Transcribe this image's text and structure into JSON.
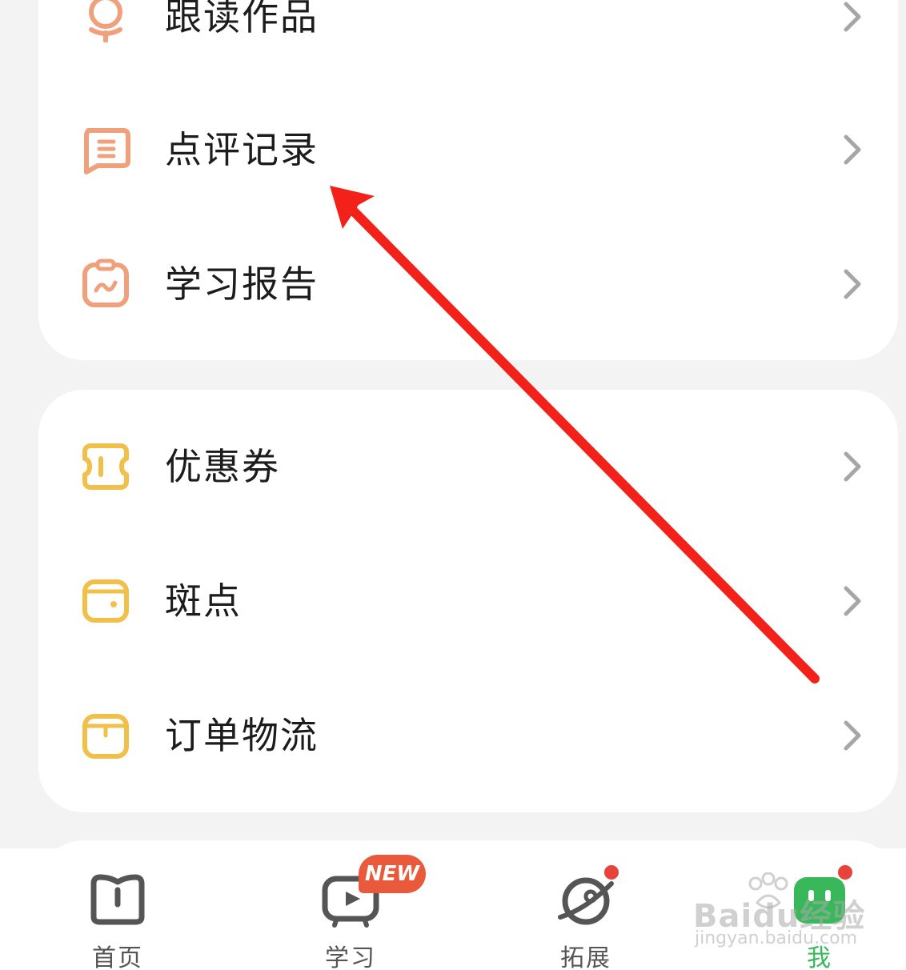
{
  "menu_groups": [
    {
      "items": [
        {
          "label": "跟读作品",
          "icon": "microphone-icon",
          "color": "#f0a07a"
        },
        {
          "label": "点评记录",
          "icon": "comment-record-icon",
          "color": "#f0a07a"
        },
        {
          "label": "学习报告",
          "icon": "study-report-icon",
          "color": "#f0a07a"
        }
      ]
    },
    {
      "items": [
        {
          "label": "优惠券",
          "icon": "coupon-icon",
          "color": "#f0c04a"
        },
        {
          "label": "斑点",
          "icon": "wallet-icon",
          "color": "#f0c04a"
        },
        {
          "label": "订单物流",
          "icon": "package-icon",
          "color": "#f0c04a"
        }
      ]
    }
  ],
  "tabbar": {
    "tabs": [
      {
        "label": "首页",
        "icon": "book-home-icon"
      },
      {
        "label": "学习",
        "icon": "tv-play-icon",
        "badge": "NEW"
      },
      {
        "label": "拓展",
        "icon": "planet-icon",
        "dot": true
      },
      {
        "label": "我",
        "icon": "profile-face-icon",
        "dot": true,
        "active": true
      }
    ]
  },
  "watermark": {
    "logo": "Baidu经验",
    "sub": "jingyan.baidu.com"
  },
  "colors": {
    "accent_green": "#38b85a",
    "annotation_red": "#f2211a",
    "badge_orange": "#e85a3b"
  }
}
